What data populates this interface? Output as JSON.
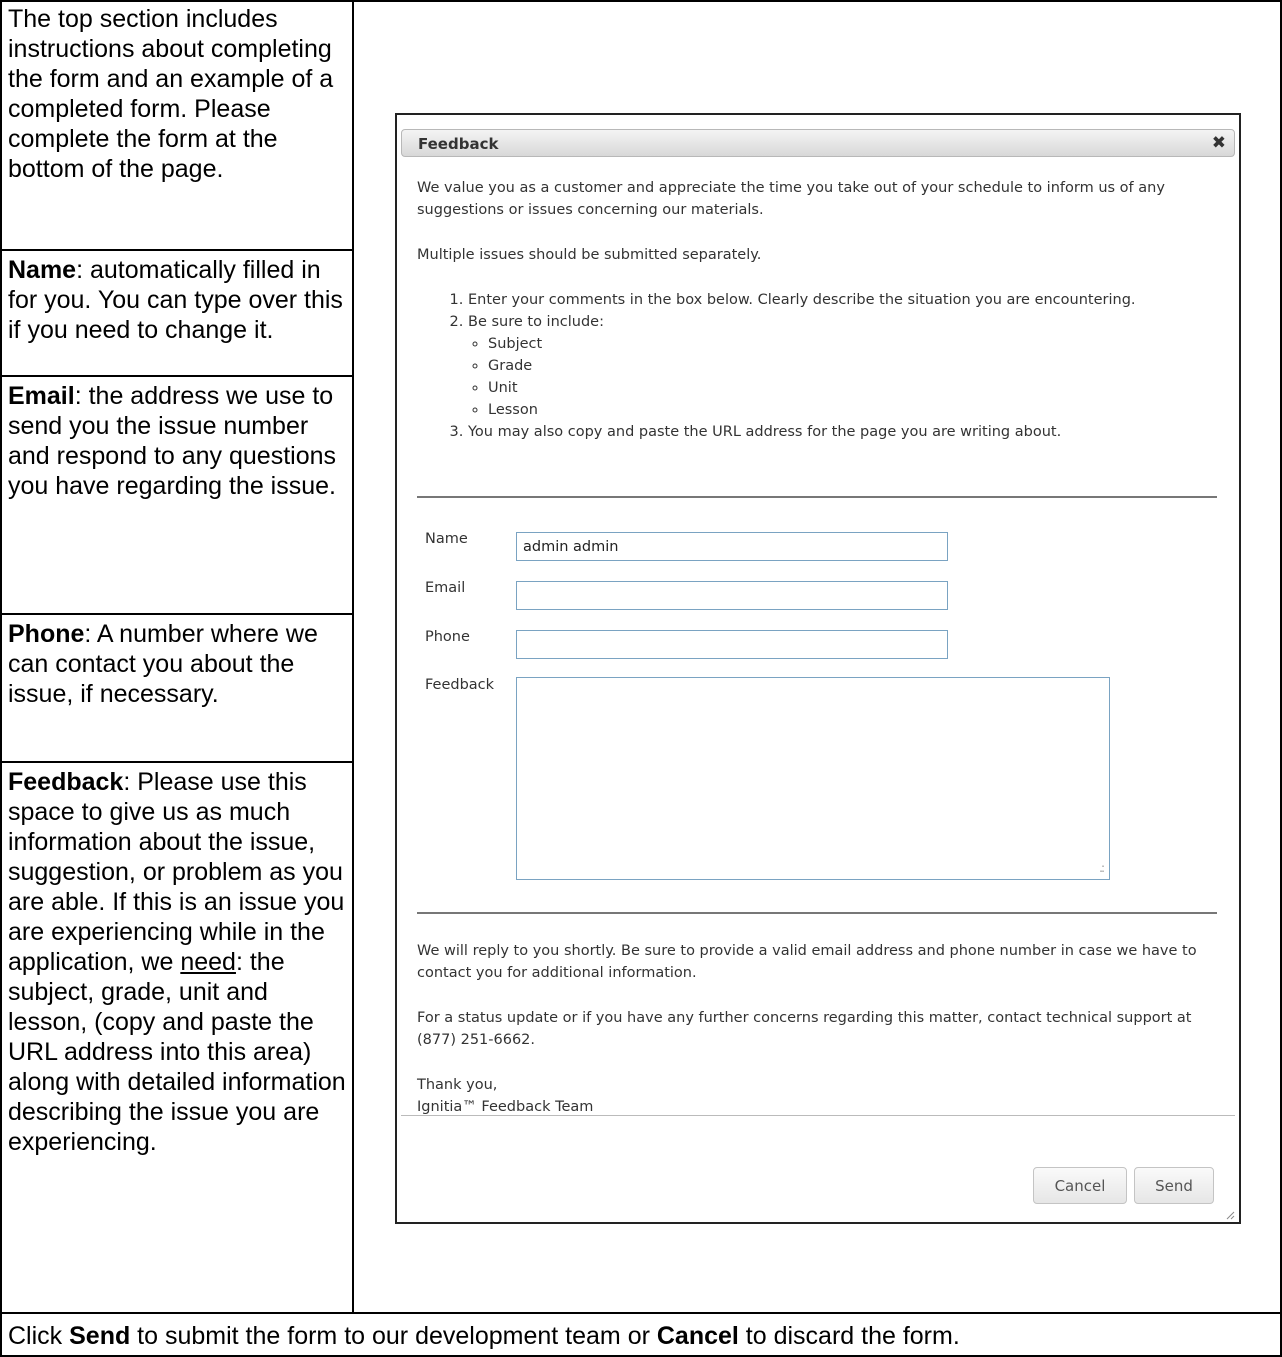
{
  "left_column": {
    "intro": "The top section includes instructions about completing the form and an example of a completed form. Please complete the form at the bottom of the page.",
    "name_label": "Name",
    "name_text": ": automatically filled in for you. You can type over this if you need to change it.",
    "email_label": "Email",
    "email_text": ": the address we use to send you the issue number and respond to any questions you have regarding the issue.",
    "phone_label": "Phone",
    "phone_text": ": A number where we can contact you about the issue, if necessary.",
    "feedback_label": "Feedback",
    "feedback_text_1": ": Please use this space to give us as much information about the issue, suggestion, or problem as you are able. If this is an issue you are experiencing while in the application, we ",
    "feedback_need": "need",
    "feedback_text_2": ": the subject, grade, unit and lesson, (copy and paste the URL address into this area) along with detailed information describing the issue you are experiencing."
  },
  "bottom_row": {
    "pre": "Click ",
    "send": "Send",
    "mid": " to submit the form to our development team or ",
    "cancel": "Cancel",
    "post": " to discard the form."
  },
  "dialog": {
    "title": "Feedback",
    "close_glyph": "✖",
    "intro_1": "We value you as a customer and appreciate the time you take out of your schedule to inform us of any suggestions or issues concerning our materials.",
    "intro_2": "Multiple issues should be submitted separately.",
    "steps": [
      "Enter your comments in the box below. Clearly describe the situation you are encountering.",
      "Be sure to include:",
      "You may also copy and paste the URL address for the page you are writing about."
    ],
    "include_items": [
      "Subject",
      "Grade",
      "Unit",
      "Lesson"
    ],
    "form": {
      "name_label": "Name",
      "name_value": "admin admin",
      "email_label": "Email",
      "email_value": "",
      "phone_label": "Phone",
      "phone_value": "",
      "feedback_label": "Feedback",
      "feedback_value": ""
    },
    "footer_1": "We will reply to you shortly. Be sure to provide a valid email address and phone number in case we have to contact you for additional information.",
    "footer_2": "For a status update or if you have any further concerns regarding this matter, contact technical support at (877) 251-6662.",
    "footer_3": "Thank you,",
    "footer_4": "Ignitia™ Feedback Team",
    "cancel_label": "Cancel",
    "send_label": "Send"
  }
}
